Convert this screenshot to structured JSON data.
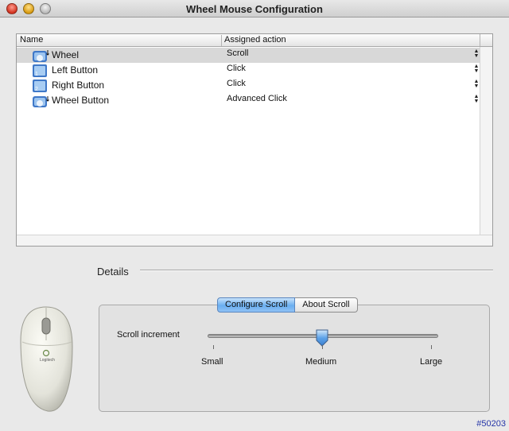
{
  "window": {
    "title": "Wheel Mouse Configuration"
  },
  "table": {
    "columns": {
      "name": "Name",
      "action": "Assigned action"
    },
    "rows": [
      {
        "name": "Wheel",
        "action": "Scroll",
        "icon": "wheel-icon",
        "selected": true
      },
      {
        "name": "Left Button",
        "action": "Click",
        "icon": "left-button-icon",
        "selected": false
      },
      {
        "name": "Right Button",
        "action": "Click",
        "icon": "right-button-icon",
        "selected": false
      },
      {
        "name": "Wheel Button",
        "action": "Advanced Click",
        "icon": "wheel-button-icon",
        "selected": false
      }
    ]
  },
  "details": {
    "label": "Details",
    "tabs": [
      {
        "label": "Configure Scroll",
        "active": true
      },
      {
        "label": "About Scroll",
        "active": false
      }
    ],
    "slider": {
      "label": "Scroll increment",
      "ticks": [
        "Small",
        "Medium",
        "Large"
      ],
      "value_label": "Medium",
      "fraction": 0.5
    }
  },
  "mouse_logo_text": "Logitech",
  "footer_id": "#50203",
  "colors": {
    "accent": "#69aef0",
    "selected_row": "#d8d8d8",
    "footer_id": "#2535a8"
  }
}
